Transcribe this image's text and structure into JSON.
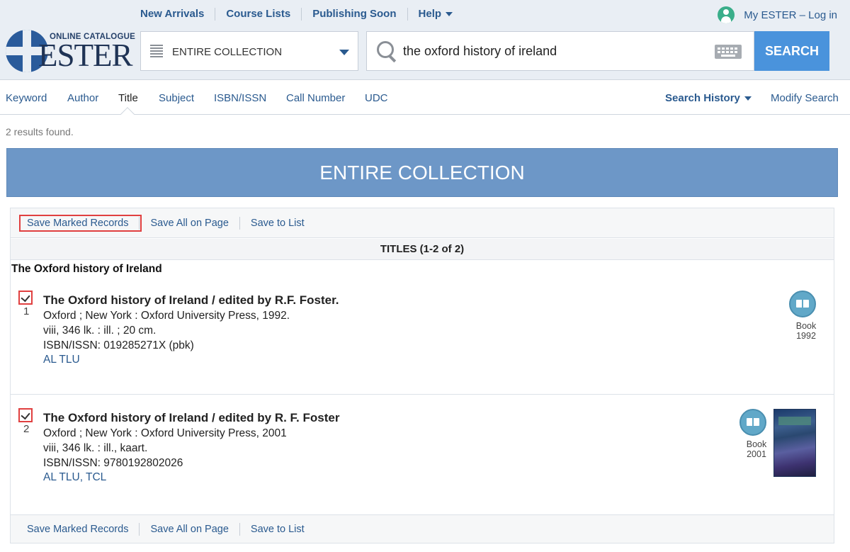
{
  "header": {
    "nav": [
      "New Arrivals",
      "Course Lists",
      "Publishing Soon",
      "Help"
    ],
    "my_ester": "My ESTER – Log in",
    "logo_sub": "ONLINE CATALOGUE",
    "logo_main": "ESTER",
    "collection": "ENTIRE COLLECTION",
    "search_value": "the oxford history of ireland",
    "search_button": "SEARCH"
  },
  "tabs": {
    "items": [
      "Keyword",
      "Author",
      "Title",
      "Subject",
      "ISBN/ISSN",
      "Call Number",
      "UDC"
    ],
    "active": "Title",
    "search_history": "Search History",
    "modify_search": "Modify Search"
  },
  "results": {
    "count": "2 results found.",
    "banner": "ENTIRE COLLECTION",
    "actions": [
      "Save Marked Records",
      "Save All on Page",
      "Save to List"
    ],
    "titles_head": "TITLES (1-2 of 2)",
    "group_title": "The Oxford history of Ireland",
    "records": [
      {
        "num": "1",
        "title": "The Oxford history of Ireland / edited by R.F. Foster.",
        "pub": "Oxford ; New York : Oxford University Press, 1992.",
        "desc": "viii, 346 lk. : ill. ; 20 cm.",
        "isbn": "ISBN/ISSN:  019285271X (pbk)",
        "location": "AL TLU",
        "format": "Book",
        "year": "1992"
      },
      {
        "num": "2",
        "title": "The Oxford history of Ireland / edited by R. F. Foster",
        "pub": "Oxford ; New York : Oxford University Press, 2001",
        "desc": "viii, 346 lk. : ill., kaart.",
        "isbn": "ISBN/ISSN:  9780192802026",
        "location": "AL TLU, TCL",
        "format": "Book",
        "year": "2001"
      }
    ]
  },
  "colors": {
    "link": "#2a5a8f",
    "banner": "#6d97c7",
    "search_button": "#4a93dc",
    "highlight": "#e04040"
  }
}
